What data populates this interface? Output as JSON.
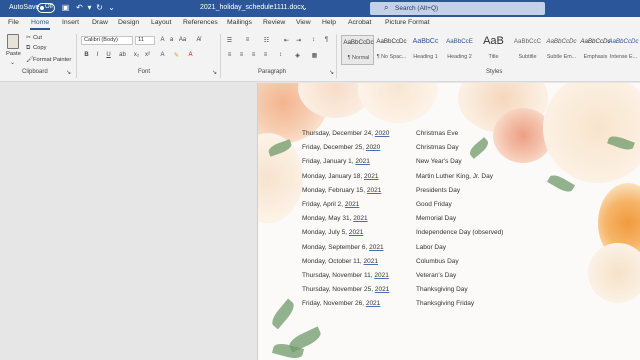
{
  "titlebar": {
    "autosave_label": "AutoSave",
    "autosave_state": "Off",
    "filename": "2021_holiday_schedule1111.docx",
    "search_placeholder": "Search (Alt+Q)"
  },
  "tabs": [
    "File",
    "Home",
    "Insert",
    "Draw",
    "Design",
    "Layout",
    "References",
    "Mailings",
    "Review",
    "View",
    "Help",
    "Acrobat",
    "Picture Format"
  ],
  "active_tab": "Home",
  "ribbon": {
    "clipboard": {
      "paste": "Paste",
      "cut": "Cut",
      "copy": "Copy",
      "format_painter": "Format Painter",
      "label": "Clipboard"
    },
    "font": {
      "name": "Calibri (Body)",
      "size": "11",
      "label": "Font"
    },
    "paragraph": {
      "label": "Paragraph"
    },
    "styles": {
      "label": "Styles",
      "items": [
        {
          "preview": "AaBbCcDc",
          "name": "¶ Normal"
        },
        {
          "preview": "AaBbCcDc",
          "name": "¶ No Spac..."
        },
        {
          "preview": "AaBbCc",
          "name": "Heading 1"
        },
        {
          "preview": "AaBbCcE",
          "name": "Heading 2"
        },
        {
          "preview": "AaB",
          "name": "Title"
        },
        {
          "preview": "AaBbCcC",
          "name": "Subtitle"
        },
        {
          "preview": "AaBbCcDc",
          "name": "Subtle Em..."
        },
        {
          "preview": "AaBbCcDc",
          "name": "Emphasis"
        },
        {
          "preview": "AaBbCcDc",
          "name": "Intense E..."
        }
      ]
    }
  },
  "holidays": [
    {
      "date": "Thursday, December 24,",
      "year": "2020",
      "name": "Christmas Eve"
    },
    {
      "date": "Friday, December 25,",
      "year": "2020",
      "name": "Christmas Day"
    },
    {
      "date": "Friday, January 1,",
      "year": "2021",
      "name": "New Year's Day"
    },
    {
      "date": "Monday, January 18,",
      "year": "2021",
      "name": "Martin Luther King, Jr. Day"
    },
    {
      "date": "Monday, February 15,",
      "year": "2021",
      "name": "Presidents Day"
    },
    {
      "date": "Friday, April 2,",
      "year": "2021",
      "name": "Good Friday"
    },
    {
      "date": "Monday, May 31,",
      "year": "2021",
      "name": "Memorial Day"
    },
    {
      "date": "Monday, July 5,",
      "year": "2021",
      "name": "Independence Day (observed)"
    },
    {
      "date": "Monday, September 6,",
      "year": "2021",
      "name": "Labor Day"
    },
    {
      "date": "Monday, October 11,",
      "year": "2021",
      "name": "Columbus Day"
    },
    {
      "date": "Thursday, November 11,",
      "year": "2021",
      "name": "Veteran's Day"
    },
    {
      "date": "Thursday, November 25,",
      "year": "2021",
      "name": "Thanksgiving Day"
    },
    {
      "date": "Friday, November 26,",
      "year": "2021",
      "name": "Thanksgiving Friday"
    }
  ]
}
